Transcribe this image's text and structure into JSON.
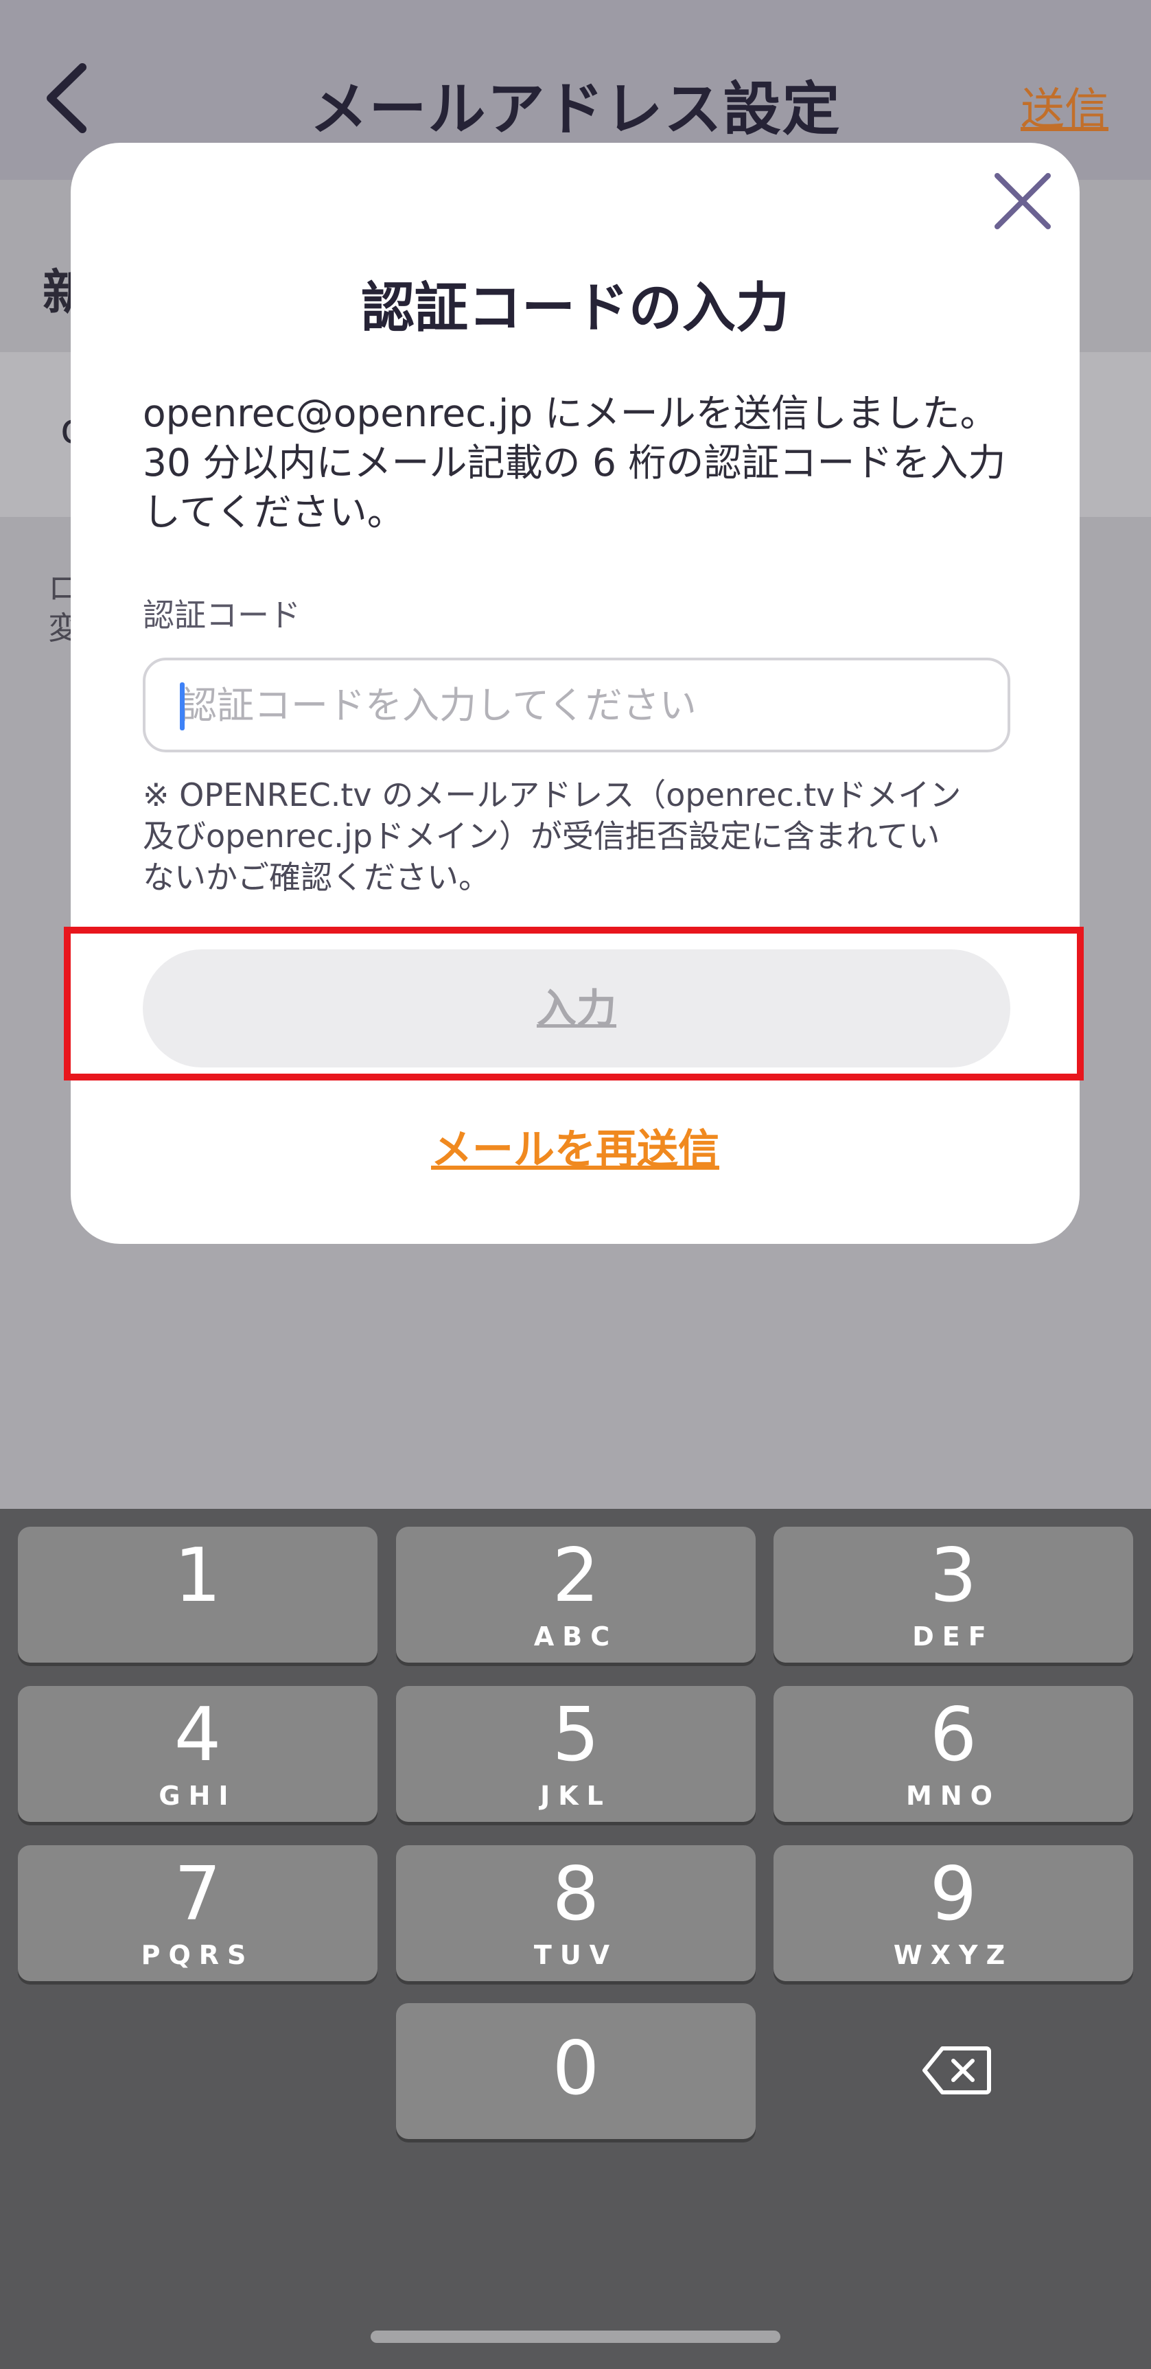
{
  "header": {
    "title": "メールアドレス設定",
    "send_label": "送信"
  },
  "background": {
    "peek_heading": "新",
    "peek_field": "o",
    "peek_note_line1": "ロ",
    "peek_note_line2": "変"
  },
  "modal": {
    "title": "認証コードの入力",
    "description_line1": "openrec@openrec.jp にメールを送信しました。",
    "description_line2": "30 分以内にメール記載の 6 桁の認証コードを入力",
    "description_line3": "してください。",
    "code_label": "認証コード",
    "code_placeholder": "認証コードを入力してください",
    "code_value": "",
    "note_line1": "※ OPENREC.tv のメールアドレス（openrec.tvドメイン",
    "note_line2": "及びopenrec.jpドメイン）が受信拒否設定に含まれてい",
    "note_line3": "ないかご確認ください。",
    "submit_label": "入力",
    "resend_label": "メールを再送信"
  },
  "keyboard": {
    "keys": [
      {
        "num": "1",
        "letters": ""
      },
      {
        "num": "2",
        "letters": "ABC"
      },
      {
        "num": "3",
        "letters": "DEF"
      },
      {
        "num": "4",
        "letters": "GHI"
      },
      {
        "num": "5",
        "letters": "JKL"
      },
      {
        "num": "6",
        "letters": "MNO"
      },
      {
        "num": "7",
        "letters": "PQRS"
      },
      {
        "num": "8",
        "letters": "TUV"
      },
      {
        "num": "9",
        "letters": "WXYZ"
      },
      {
        "num": "0",
        "letters": ""
      }
    ]
  },
  "colors": {
    "accent_orange": "#f0891f",
    "highlight_red": "#e8161d",
    "title_dark": "#262336",
    "close_purple": "#6b6292"
  },
  "icons": {
    "back": "chevron-left-icon",
    "close": "close-icon",
    "delete": "backspace-icon"
  }
}
